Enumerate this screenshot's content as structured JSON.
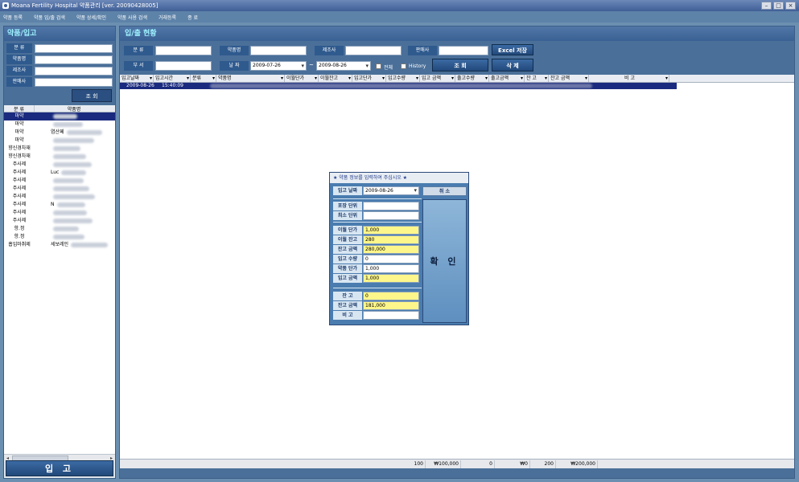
{
  "window": {
    "title": "Moana Fertility Hospital 약품관리 [ver. 20090428005]"
  },
  "menu": [
    "약품 등록",
    "약품 입/출 검색",
    "약품 상세/확인",
    "약품 사용 검색",
    "거래등록",
    "종 료"
  ],
  "left": {
    "header": "약품/입고",
    "form": [
      {
        "label": "분 류"
      },
      {
        "label": "약품명"
      },
      {
        "label": "제조사"
      },
      {
        "label": "판매사"
      }
    ],
    "search_label": "조 회",
    "list_columns": [
      "분 류",
      "약품명"
    ],
    "list_rows": [
      {
        "category": "마약",
        "name": "",
        "selected": true
      },
      {
        "category": "마약",
        "name": ""
      },
      {
        "category": "마약",
        "name": "염산페"
      },
      {
        "category": "마약",
        "name": ""
      },
      {
        "category": "향신경차재",
        "name": ""
      },
      {
        "category": "향신경차재",
        "name": ""
      },
      {
        "category": "주사제",
        "name": ""
      },
      {
        "category": "주사제",
        "name": "Luc"
      },
      {
        "category": "주사제",
        "name": ""
      },
      {
        "category": "주사제",
        "name": ""
      },
      {
        "category": "주사제",
        "name": ""
      },
      {
        "category": "주사제",
        "name": "N"
      },
      {
        "category": "주사제",
        "name": ""
      },
      {
        "category": "주사제",
        "name": ""
      },
      {
        "category": "항.정",
        "name": ""
      },
      {
        "category": "항.정",
        "name": ""
      },
      {
        "category": "흡입마취제",
        "name": "세보레인"
      }
    ],
    "ipgo_label": "입 고"
  },
  "right": {
    "header": "입/출 현황",
    "filters": {
      "category_label": "분 류",
      "drug_label": "약품명",
      "maker_label": "제조사",
      "seller_label": "판매사",
      "dept_label": "부 서",
      "date_label": "날 짜",
      "date_from": "2009-07-26",
      "date_to": "2009-08-26",
      "all_label": "전체",
      "history_label": "History",
      "excel_label": "Excel 저장",
      "search_label": "조 회",
      "delete_label": "삭 제"
    },
    "grid_columns": [
      "입고날짜",
      "입고시간",
      "분류",
      "약품명",
      "이월단가",
      "이월잔고",
      "입고단가",
      "입고수량",
      "입고 금액",
      "출고수량",
      "출고금액",
      "잔 고",
      "잔고 금액",
      "비 고"
    ],
    "grid_row": {
      "date": "2009-08-26",
      "time": "15:40:09"
    },
    "footer": [
      "100",
      "₩100,000",
      "0",
      "₩0",
      "200",
      "₩200,000"
    ]
  },
  "dialog": {
    "title": "★ 약품 정보를 입력하여 주십시오 ★",
    "date_label": "입고 날짜",
    "date_value": "2009-08-26",
    "cancel_label": "취 소",
    "confirm_label": "확 인",
    "fields": [
      {
        "label": "포장 단위",
        "value": "",
        "yellow": false
      },
      {
        "label": "최소 단위",
        "value": "",
        "yellow": false
      },
      {
        "label": "이월 단가",
        "value": "1,000",
        "yellow": true
      },
      {
        "label": "이월 잔고",
        "value": "280",
        "yellow": true
      },
      {
        "label": "잔고 금액",
        "value": "280,000",
        "yellow": true
      },
      {
        "label": "입고 수량",
        "value": "0",
        "yellow": false
      },
      {
        "label": "약품 단가",
        "value": "1,000",
        "yellow": false
      },
      {
        "label": "입고 금액",
        "value": "1,000",
        "yellow": true
      },
      {
        "label": "잔 고",
        "value": "0",
        "yellow": true
      },
      {
        "label": "잔고 금액",
        "value": "181,000",
        "yellow": true
      },
      {
        "label": "비 고",
        "value": "",
        "yellow": false
      }
    ]
  }
}
